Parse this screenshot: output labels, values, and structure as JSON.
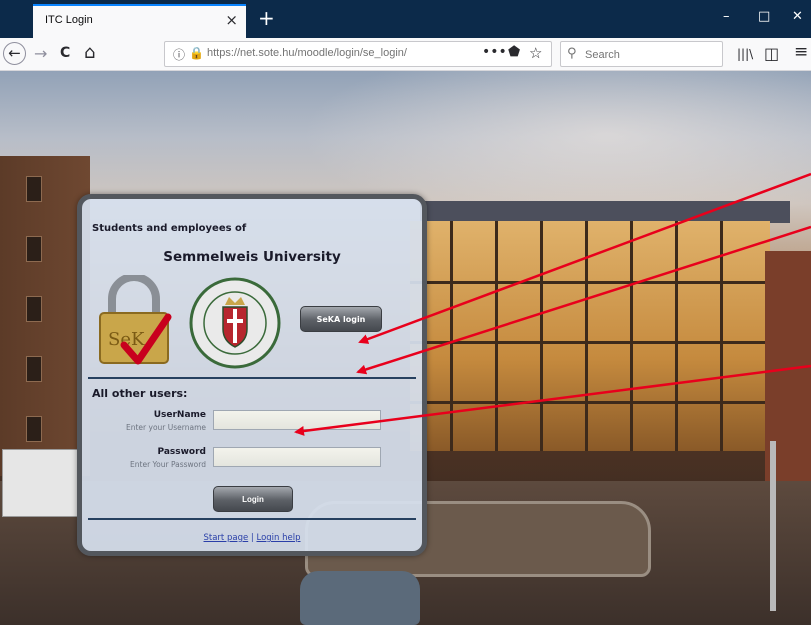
{
  "browser": {
    "tab_title": "ITC Login",
    "tab_close": "×",
    "new_tab": "+",
    "url_secure_icon": "lock-warning-icon",
    "url": "https://net.sote.hu/moodle/login/se_login/",
    "page_actions": "•••",
    "search_placeholder": "Search",
    "window_controls": {
      "minimize": "–",
      "maximize": "□",
      "close": "✕"
    },
    "nav_icons": {
      "back": "←",
      "forward": "→",
      "reload": "C",
      "home": "⌂",
      "library": "|||\\",
      "sidebar": "◫",
      "menu": "≡"
    }
  },
  "panel": {
    "intro_text": "Students and employees of",
    "university_name": "Semmelweis University",
    "seka_button": "SeKA login",
    "other_users": "All other users:",
    "username_label": "UserName",
    "username_hint": "Enter your Username",
    "password_label": "Password",
    "password_hint": "Enter Your Password",
    "login_button": "Login",
    "start_page_link": "Start page",
    "link_separator": " | ",
    "login_help_link": "Login help"
  },
  "colors": {
    "annotation_arrow": "#e8001c",
    "browser_titlebar": "#0c2a4a",
    "panel_border": "#53575d"
  }
}
